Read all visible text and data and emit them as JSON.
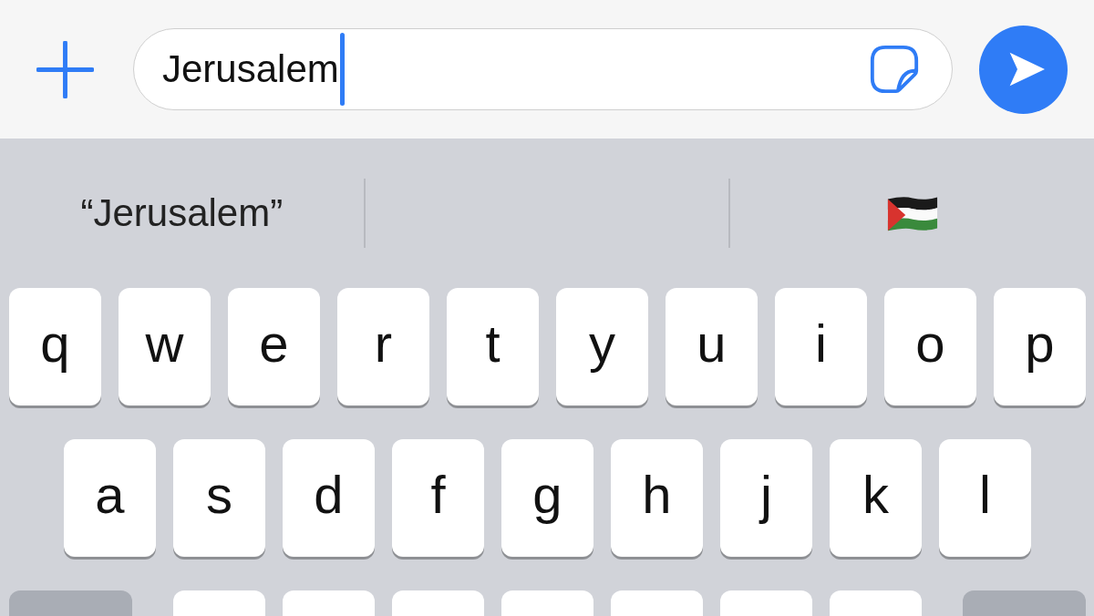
{
  "message_field": {
    "value": "Jerusalem"
  },
  "suggestions": [
    {
      "kind": "text",
      "label": "“Jerusalem”"
    },
    {
      "kind": "blank"
    },
    {
      "kind": "emoji"
    }
  ],
  "keyboard": {
    "rows": [
      [
        {
          "kind": "letter",
          "label": "q"
        },
        {
          "kind": "letter",
          "label": "w"
        },
        {
          "kind": "letter",
          "label": "e"
        },
        {
          "kind": "letter",
          "label": "r"
        },
        {
          "kind": "letter",
          "label": "t"
        },
        {
          "kind": "letter",
          "label": "y"
        },
        {
          "kind": "letter",
          "label": "u"
        },
        {
          "kind": "letter",
          "label": "i"
        },
        {
          "kind": "letter",
          "label": "o"
        },
        {
          "kind": "letter",
          "label": "p"
        }
      ],
      [
        {
          "kind": "letter",
          "label": "a"
        },
        {
          "kind": "letter",
          "label": "s"
        },
        {
          "kind": "letter",
          "label": "d"
        },
        {
          "kind": "letter",
          "label": "f"
        },
        {
          "kind": "letter",
          "label": "g"
        },
        {
          "kind": "letter",
          "label": "h"
        },
        {
          "kind": "letter",
          "label": "j"
        },
        {
          "kind": "letter",
          "label": "k"
        },
        {
          "kind": "letter",
          "label": "l"
        }
      ],
      [
        {
          "kind": "function"
        },
        {
          "kind": "letter"
        },
        {
          "kind": "letter"
        },
        {
          "kind": "letter"
        },
        {
          "kind": "letter"
        },
        {
          "kind": "letter"
        },
        {
          "kind": "letter"
        },
        {
          "kind": "letter"
        },
        {
          "kind": "function"
        }
      ]
    ]
  }
}
